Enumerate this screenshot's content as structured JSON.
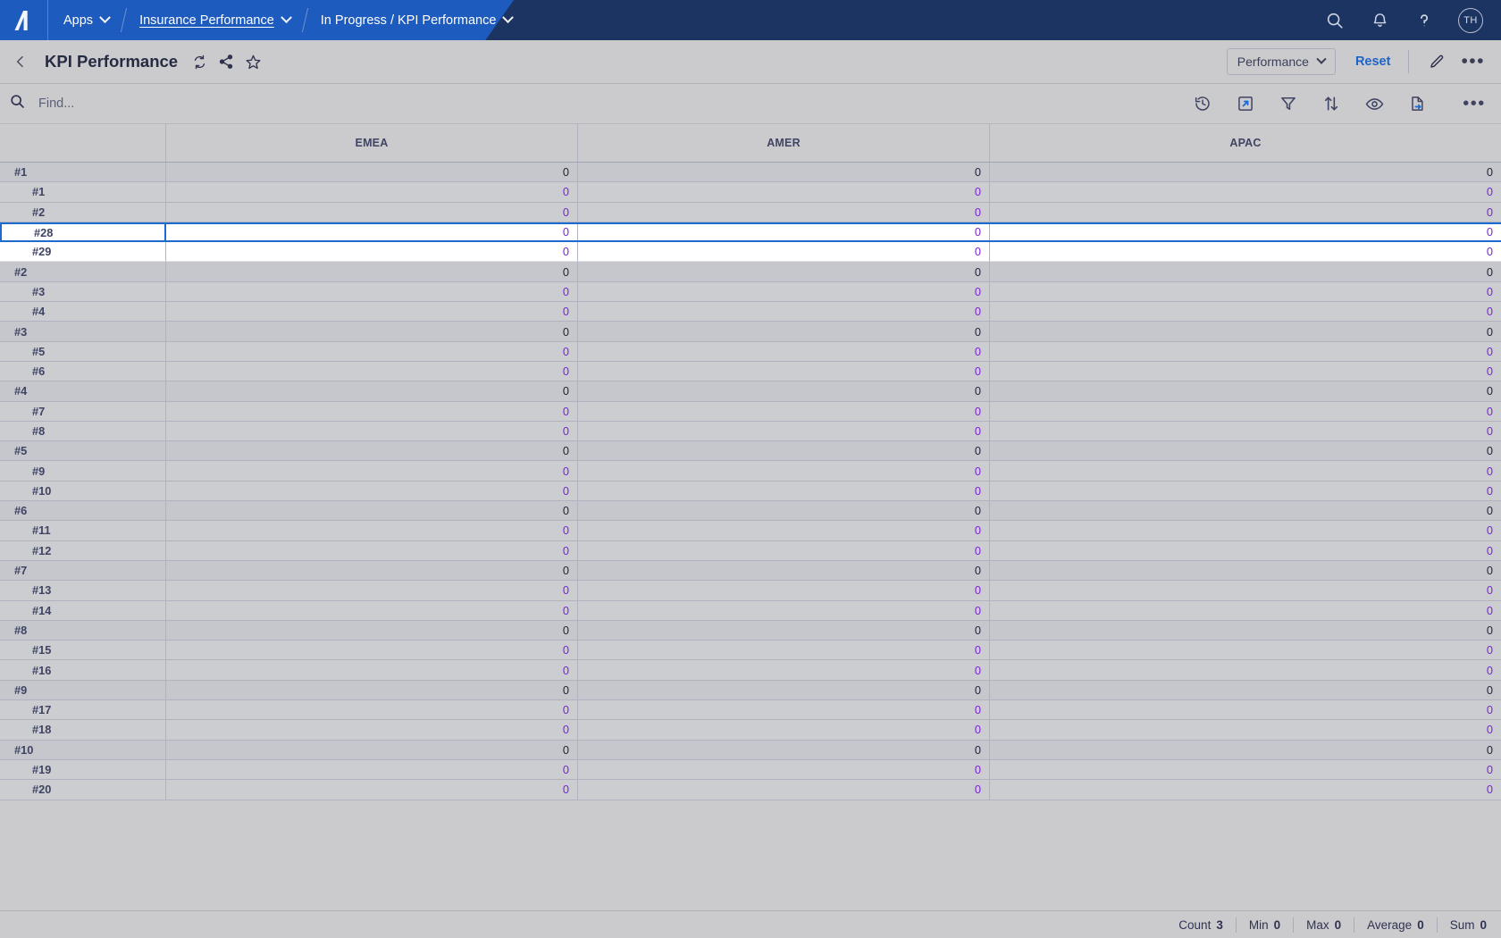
{
  "topnav": {
    "logo_icon": "appsheet-logo-icon",
    "apps_label": "Apps",
    "app_name": "Insurance Performance",
    "view_path": "In Progress / KPI Performance",
    "search_icon": "search-icon",
    "bell_icon": "notifications-bell-icon",
    "help_icon": "help-question-icon",
    "avatar_initials": "TH",
    "brand_blue": "#1d5bbf",
    "brand_navy": "#1c3461"
  },
  "pageheader": {
    "back_icon": "back-chevron-icon",
    "title": "KPI Performance",
    "sync_icon": "sync-refresh-icon",
    "share_icon": "share-icon",
    "favorite_icon": "star-outline-icon",
    "view_selector_label": "Performance",
    "reset_label": "Reset",
    "edit_icon": "pencil-edit-icon",
    "more_icon": "more-options-icon",
    "reset_color": "#1e63c8"
  },
  "searchbar": {
    "search_icon": "search-icon",
    "placeholder": "Find...",
    "value": "",
    "tools": [
      {
        "name": "history-icon",
        "title": "History"
      },
      {
        "name": "export-launch-icon",
        "title": "Open"
      },
      {
        "name": "filter-funnel-icon",
        "title": "Filter"
      },
      {
        "name": "sort-arrows-icon",
        "title": "Sort"
      },
      {
        "name": "visibility-eye-icon",
        "title": "Show/Hide"
      },
      {
        "name": "export-file-icon",
        "title": "Export"
      },
      {
        "name": "more-options-icon",
        "title": "More"
      }
    ],
    "tool_color": "#1d6ad1"
  },
  "grid": {
    "columns": [
      "",
      "EMEA",
      "AMER",
      "APAC"
    ],
    "parent_value_color": "#1f2338",
    "child_value_color": "#7d22d6",
    "selection_color": "#1d6ad1",
    "rows": [
      {
        "label": "#1",
        "level": 0,
        "values": [
          "0",
          "0",
          "0"
        ],
        "state": ""
      },
      {
        "label": "#1",
        "level": 1,
        "values": [
          "0",
          "0",
          "0"
        ],
        "state": ""
      },
      {
        "label": "#2",
        "level": 1,
        "values": [
          "0",
          "0",
          "0"
        ],
        "state": ""
      },
      {
        "label": "#28",
        "level": 1,
        "values": [
          "0",
          "0",
          "0"
        ],
        "state": "selected"
      },
      {
        "label": "#29",
        "level": 1,
        "values": [
          "0",
          "0",
          "0"
        ],
        "state": "rowwhite belowsel"
      },
      {
        "label": "#2",
        "level": 0,
        "values": [
          "0",
          "0",
          "0"
        ],
        "state": ""
      },
      {
        "label": "#3",
        "level": 1,
        "values": [
          "0",
          "0",
          "0"
        ],
        "state": ""
      },
      {
        "label": "#4",
        "level": 1,
        "values": [
          "0",
          "0",
          "0"
        ],
        "state": ""
      },
      {
        "label": "#3",
        "level": 0,
        "values": [
          "0",
          "0",
          "0"
        ],
        "state": ""
      },
      {
        "label": "#5",
        "level": 1,
        "values": [
          "0",
          "0",
          "0"
        ],
        "state": ""
      },
      {
        "label": "#6",
        "level": 1,
        "values": [
          "0",
          "0",
          "0"
        ],
        "state": ""
      },
      {
        "label": "#4",
        "level": 0,
        "values": [
          "0",
          "0",
          "0"
        ],
        "state": ""
      },
      {
        "label": "#7",
        "level": 1,
        "values": [
          "0",
          "0",
          "0"
        ],
        "state": ""
      },
      {
        "label": "#8",
        "level": 1,
        "values": [
          "0",
          "0",
          "0"
        ],
        "state": ""
      },
      {
        "label": "#5",
        "level": 0,
        "values": [
          "0",
          "0",
          "0"
        ],
        "state": ""
      },
      {
        "label": "#9",
        "level": 1,
        "values": [
          "0",
          "0",
          "0"
        ],
        "state": ""
      },
      {
        "label": "#10",
        "level": 1,
        "values": [
          "0",
          "0",
          "0"
        ],
        "state": ""
      },
      {
        "label": "#6",
        "level": 0,
        "values": [
          "0",
          "0",
          "0"
        ],
        "state": ""
      },
      {
        "label": "#11",
        "level": 1,
        "values": [
          "0",
          "0",
          "0"
        ],
        "state": ""
      },
      {
        "label": "#12",
        "level": 1,
        "values": [
          "0",
          "0",
          "0"
        ],
        "state": ""
      },
      {
        "label": "#7",
        "level": 0,
        "values": [
          "0",
          "0",
          "0"
        ],
        "state": ""
      },
      {
        "label": "#13",
        "level": 1,
        "values": [
          "0",
          "0",
          "0"
        ],
        "state": ""
      },
      {
        "label": "#14",
        "level": 1,
        "values": [
          "0",
          "0",
          "0"
        ],
        "state": ""
      },
      {
        "label": "#8",
        "level": 0,
        "values": [
          "0",
          "0",
          "0"
        ],
        "state": ""
      },
      {
        "label": "#15",
        "level": 1,
        "values": [
          "0",
          "0",
          "0"
        ],
        "state": ""
      },
      {
        "label": "#16",
        "level": 1,
        "values": [
          "0",
          "0",
          "0"
        ],
        "state": ""
      },
      {
        "label": "#9",
        "level": 0,
        "values": [
          "0",
          "0",
          "0"
        ],
        "state": ""
      },
      {
        "label": "#17",
        "level": 1,
        "values": [
          "0",
          "0",
          "0"
        ],
        "state": ""
      },
      {
        "label": "#18",
        "level": 1,
        "values": [
          "0",
          "0",
          "0"
        ],
        "state": ""
      },
      {
        "label": "#10",
        "level": 0,
        "values": [
          "0",
          "0",
          "0"
        ],
        "state": ""
      },
      {
        "label": "#19",
        "level": 1,
        "values": [
          "0",
          "0",
          "0"
        ],
        "state": ""
      },
      {
        "label": "#20",
        "level": 1,
        "values": [
          "0",
          "0",
          "0"
        ],
        "state": ""
      }
    ]
  },
  "statusbar": {
    "stats": [
      {
        "label": "Count",
        "value": "3"
      },
      {
        "label": "Min",
        "value": "0"
      },
      {
        "label": "Max",
        "value": "0"
      },
      {
        "label": "Average",
        "value": "0"
      },
      {
        "label": "Sum",
        "value": "0"
      }
    ]
  }
}
